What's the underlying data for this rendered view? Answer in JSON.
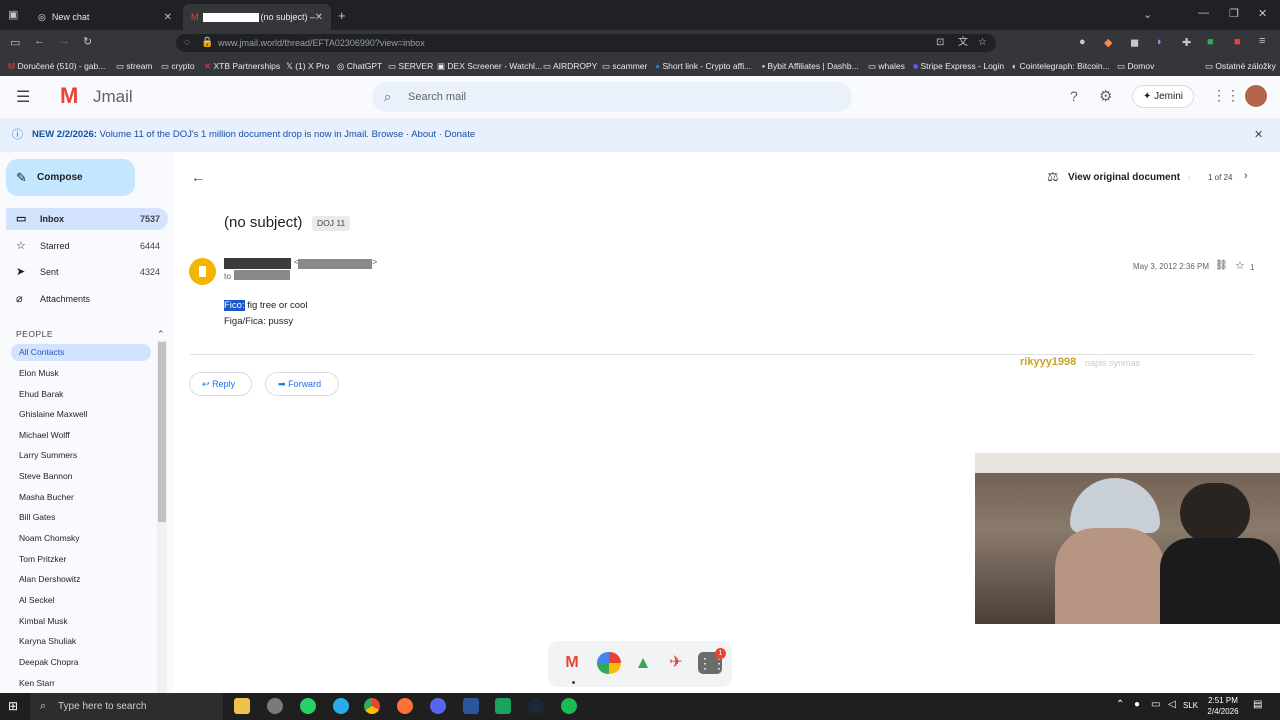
{
  "browser": {
    "tabs": [
      {
        "title": "New chat"
      },
      {
        "title": "(no subject) –"
      }
    ],
    "url": "www.jmail.world/thread/EFTA02306990?view=inbox",
    "bookmarks": [
      "Doručené (510) - gab...",
      "stream",
      "crypto",
      "XTB Partnerships",
      "(1) X Pro",
      "ChatGPT",
      "SERVER",
      "DEX Screener - Watchl...",
      "AIRDROPY",
      "scammer",
      "Short link - Crypto affi...",
      "Bybit Affiliates | Dashb...",
      "whales",
      "Stripe Express - Login",
      "Cointelegraph: Bitcoin...",
      "Domov"
    ],
    "other_bookmarks": "Ostatné záložky"
  },
  "app": {
    "name": "Jmail",
    "search_placeholder": "Search mail",
    "jemini_label": "Jemini"
  },
  "banner": {
    "prefix": "NEW 2/2/2026:",
    "text": "Volume 11 of the DOJ's 1 million document drop is now in Jmail.",
    "links": [
      "Browse",
      "About",
      "Donate"
    ],
    "sep": "·"
  },
  "sidebar": {
    "compose": "Compose",
    "nav": [
      {
        "label": "Inbox",
        "count": "7537",
        "icon": "inbox-icon"
      },
      {
        "label": "Starred",
        "count": "6444",
        "icon": "star-icon"
      },
      {
        "label": "Sent",
        "count": "4324",
        "icon": "send-icon"
      },
      {
        "label": "Attachments",
        "count": "",
        "icon": "paperclip-icon"
      }
    ],
    "people_title": "PEOPLE",
    "contacts": [
      "All Contacts",
      "Elon Musk",
      "Ehud Barak",
      "Ghislaine Maxwell",
      "Michael Wolff",
      "Larry Summers",
      "Steve Bannon",
      "Masha Bucher",
      "Bill Gates",
      "Noam Chomsky",
      "Tom Pritzker",
      "Alan Dershowitz",
      "Al Seckel",
      "Kimbal Musk",
      "Karyna Shuliak",
      "Deepak Chopra",
      "Ken Starr"
    ]
  },
  "email": {
    "view_original": "View original document",
    "pager": "1 of 24",
    "subject": "(no subject)",
    "tag": "DOJ 11",
    "to_prefix": "to",
    "date": "May 3, 2012 2:36 PM",
    "star_count": "1",
    "body_line1_highlight": "Fico:",
    "body_line1_rest": "fig tree or cool",
    "body_line2": "Figa/Fica: pussy",
    "reply": "Reply",
    "forward": "Forward"
  },
  "overlay": {
    "username": "rikyyy1998",
    "caption": "napis synmas"
  },
  "taskbar": {
    "search": "Type here to search",
    "lang": "SLK",
    "time": "2:51 PM",
    "date": "2/4/2026"
  },
  "dock": {
    "badge": "1"
  }
}
